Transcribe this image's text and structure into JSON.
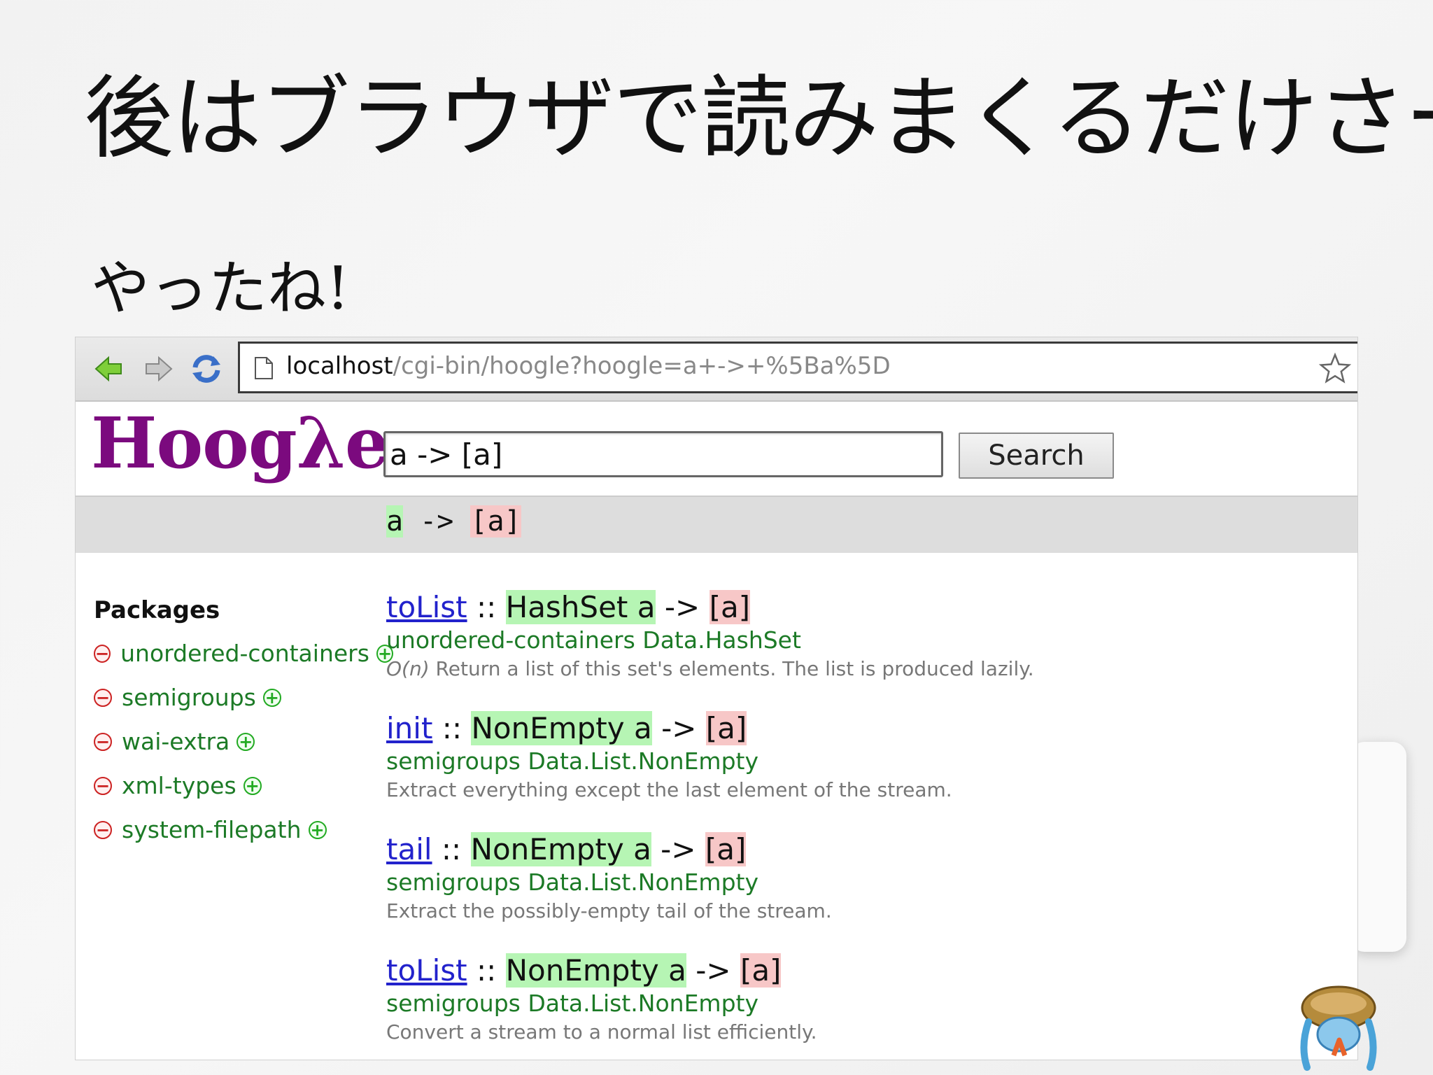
{
  "slide": {
    "title": "後はブラウザで読みまくるだけさー",
    "subtitle": "やったね!"
  },
  "browser": {
    "url_host": "localhost",
    "url_path": "/cgi-bin/hoogle?hoogle=a+->+%5Ba%5D"
  },
  "hoogle": {
    "logo": "Hoogλe",
    "search_value": "a -> [a]",
    "search_button": "Search",
    "query": {
      "var": "a",
      "arrow": " -> ",
      "list": "[a]"
    }
  },
  "sidebar": {
    "title": "Packages",
    "items": [
      {
        "label": "unordered-containers"
      },
      {
        "label": "semigroups"
      },
      {
        "label": "wai-extra"
      },
      {
        "label": "xml-types"
      },
      {
        "label": "system-filepath"
      }
    ]
  },
  "results": [
    {
      "name": "toList",
      "sep": " :: ",
      "arg": "HashSet a",
      "arrow": " -> ",
      "ret": "[a]",
      "pkg": "unordered-containers Data.HashSet",
      "doc_prefix": "O(n)",
      "doc": " Return a list of this set's elements. The list is produced lazily."
    },
    {
      "name": "init",
      "sep": " :: ",
      "arg": "NonEmpty a",
      "arrow": " -> ",
      "ret": "[a]",
      "pkg": "semigroups Data.List.NonEmpty",
      "doc_prefix": "",
      "doc": "Extract everything except the last element of the stream."
    },
    {
      "name": "tail",
      "sep": " :: ",
      "arg": "NonEmpty a",
      "arrow": " -> ",
      "ret": "[a]",
      "pkg": "semigroups Data.List.NonEmpty",
      "doc_prefix": "",
      "doc": "Extract the possibly-empty tail of the stream."
    },
    {
      "name": "toList",
      "sep": " :: ",
      "arg": "NonEmpty a",
      "arrow": " -> ",
      "ret": "[a]",
      "pkg": "semigroups Data.List.NonEmpty",
      "doc_prefix": "",
      "doc": "Convert a stream to a normal list efficiently."
    }
  ],
  "colors": {
    "logo": "#7b0a7e",
    "link": "#2222cc",
    "package": "#1c7a26",
    "highlight_arg": "#b6f5b4",
    "highlight_ret": "#f7c7c7"
  }
}
